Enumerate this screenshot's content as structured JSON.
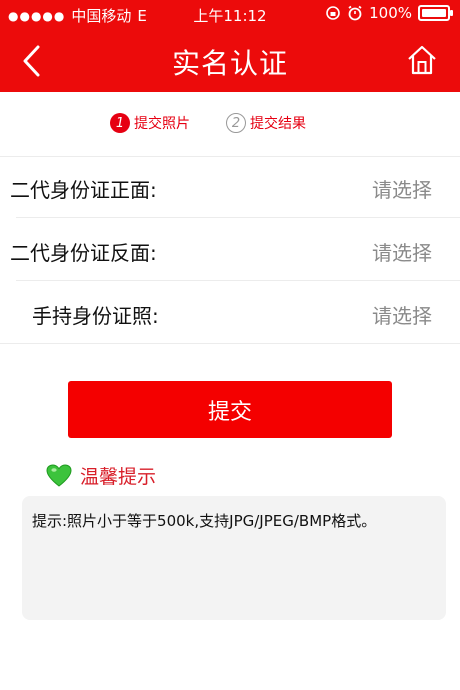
{
  "statusbar": {
    "carrier": "中国移动",
    "network": "E",
    "time": "上午11:12",
    "battery": "100%"
  },
  "navbar": {
    "title": "实名认证",
    "back_icon": "chevron-left-icon",
    "home_icon": "home-icon"
  },
  "steps": [
    {
      "num": "1",
      "label": "提交照片",
      "active": true
    },
    {
      "num": "2",
      "label": "提交结果",
      "active": false
    }
  ],
  "form": {
    "rows": [
      {
        "label": "二代身份证正面:",
        "value": "请选择"
      },
      {
        "label": "二代身份证反面:",
        "value": "请选择"
      },
      {
        "label": "手持身份证照:",
        "value": "请选择"
      }
    ]
  },
  "submit_label": "提交",
  "tip": {
    "icon": "green-heart-icon",
    "title": "温馨提示",
    "content": "提示:照片小于等于500k,支持JPG/JPEG/BMP格式。"
  },
  "colors": {
    "brand_red": "#ec0b0b",
    "accent_red": "#e60012",
    "heart_green": "#3cc33c"
  }
}
